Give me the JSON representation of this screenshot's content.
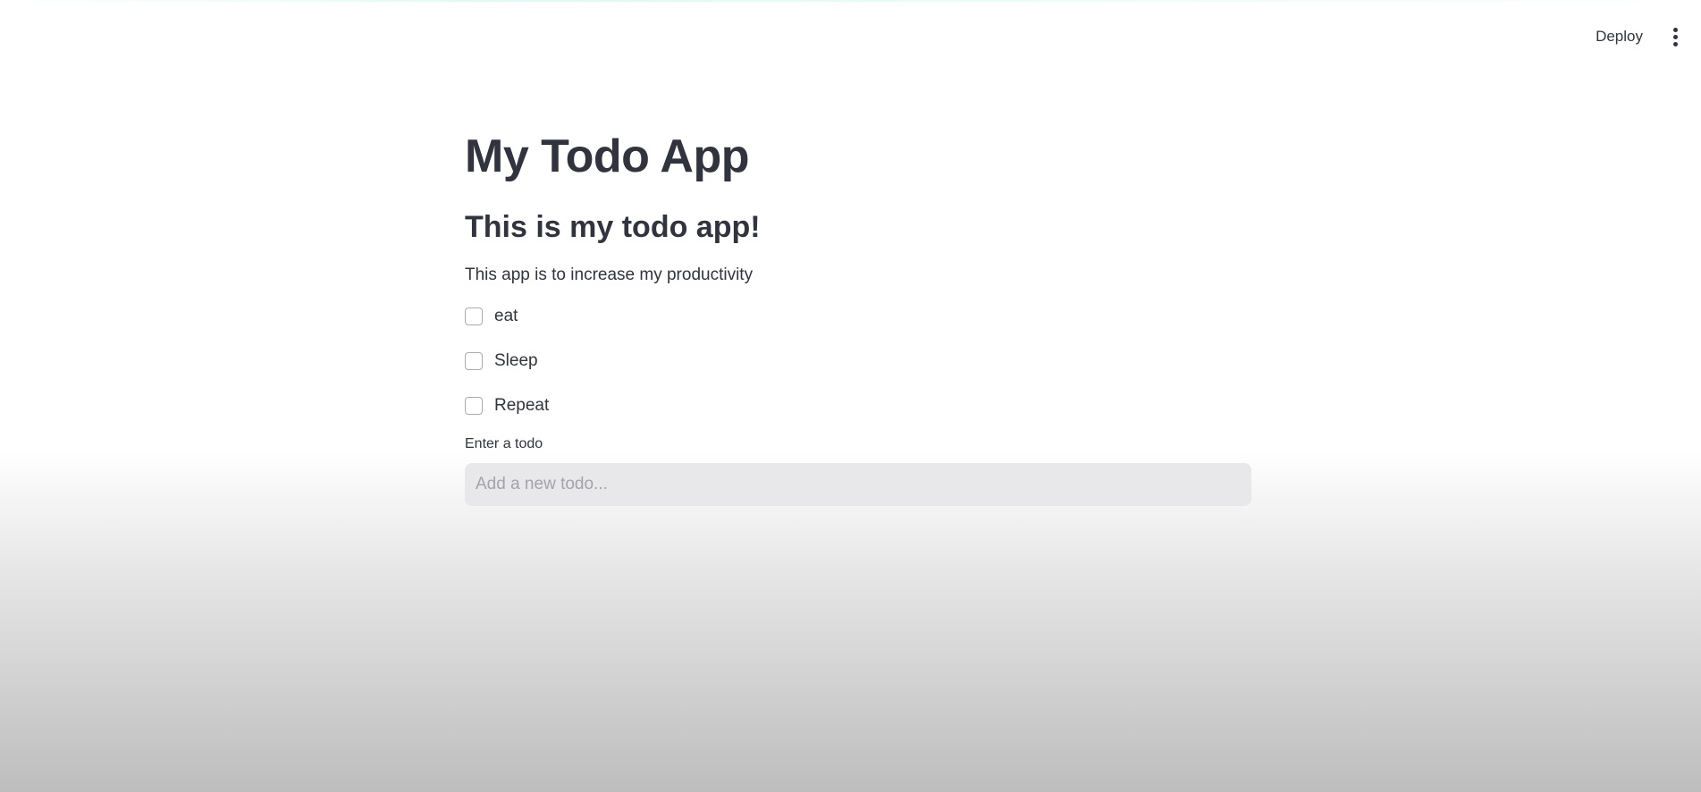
{
  "header": {
    "deploy_label": "Deploy",
    "menu_icon": "vertical-ellipsis-icon"
  },
  "main": {
    "title": "My Todo App",
    "subheader": "This is my todo app!",
    "description": "This app is to increase my productivity",
    "todos": [
      {
        "label": "eat",
        "checked": false
      },
      {
        "label": "Sleep",
        "checked": false
      },
      {
        "label": "Repeat",
        "checked": false
      }
    ],
    "input": {
      "label": "Enter a todo",
      "value": "",
      "placeholder": "Add a new todo..."
    }
  },
  "colors": {
    "text": "#31333f",
    "input_bg": "#e8e8eb"
  }
}
